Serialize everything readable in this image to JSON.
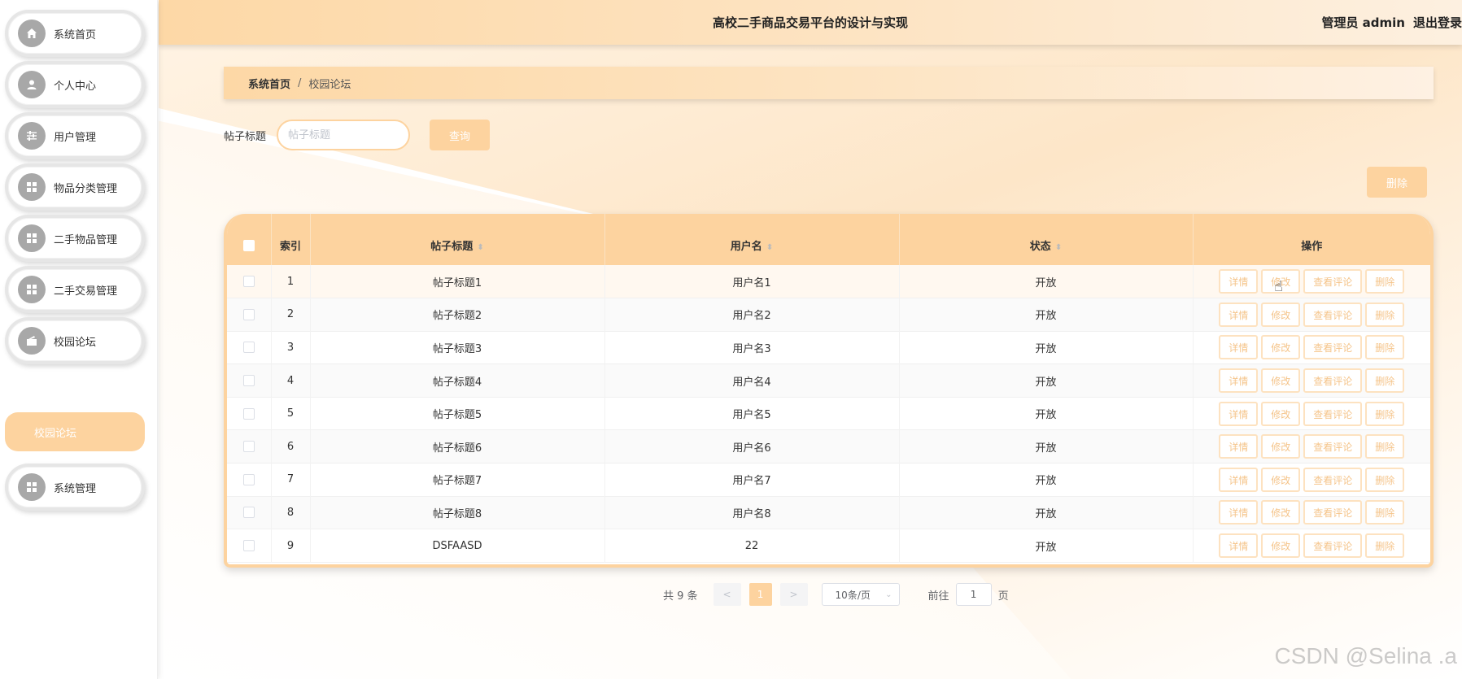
{
  "app": {
    "title": "高校二手商品交易平台的设计与实现",
    "user_label": "管理员 admin",
    "logout_label": "退出登录"
  },
  "sidebar": {
    "items": [
      {
        "label": "系统首页",
        "icon": "home-icon"
      },
      {
        "label": "个人中心",
        "icon": "user-icon"
      },
      {
        "label": "用户管理",
        "icon": "sliders-icon"
      },
      {
        "label": "物品分类管理",
        "icon": "grid-icon"
      },
      {
        "label": "二手物品管理",
        "icon": "grid-icon"
      },
      {
        "label": "二手交易管理",
        "icon": "grid-icon"
      },
      {
        "label": "校园论坛",
        "icon": "forum-icon"
      },
      {
        "label": "系统管理",
        "icon": "grid-icon"
      }
    ],
    "submenu_active": "校园论坛"
  },
  "breadcrumb": {
    "home": "系统首页",
    "separator": "/",
    "current": "校园论坛"
  },
  "search": {
    "label": "帖子标题",
    "placeholder": "帖子标题",
    "value": "",
    "query_button": "查询",
    "delete_button": "删除"
  },
  "table": {
    "columns": {
      "index": "索引",
      "title": "帖子标题",
      "username": "用户名",
      "status": "状态",
      "actions": "操作"
    },
    "rows": [
      {
        "index": "1",
        "title": "帖子标题1",
        "username": "用户名1",
        "status": "开放"
      },
      {
        "index": "2",
        "title": "帖子标题2",
        "username": "用户名2",
        "status": "开放"
      },
      {
        "index": "3",
        "title": "帖子标题3",
        "username": "用户名3",
        "status": "开放"
      },
      {
        "index": "4",
        "title": "帖子标题4",
        "username": "用户名4",
        "status": "开放"
      },
      {
        "index": "5",
        "title": "帖子标题5",
        "username": "用户名5",
        "status": "开放"
      },
      {
        "index": "6",
        "title": "帖子标题6",
        "username": "用户名6",
        "status": "开放"
      },
      {
        "index": "7",
        "title": "帖子标题7",
        "username": "用户名7",
        "status": "开放"
      },
      {
        "index": "8",
        "title": "帖子标题8",
        "username": "用户名8",
        "status": "开放"
      },
      {
        "index": "9",
        "title": "DSFAASD",
        "username": "22",
        "status": "开放"
      }
    ],
    "row_actions": {
      "detail": "详情",
      "edit": "修改",
      "comments": "查看评论",
      "delete": "删除"
    }
  },
  "pagination": {
    "total": "共 9 条",
    "prev": "<",
    "current_page": "1",
    "next": ">",
    "page_size": "10条/页",
    "jump_label": "前往",
    "jump_value": "1",
    "page_suffix": "页"
  },
  "watermark": "CSDN @Selina .a",
  "colors": {
    "accent": "#fdd39f",
    "header_start": "#fdd8a6",
    "action_text": "#f5c48a"
  }
}
